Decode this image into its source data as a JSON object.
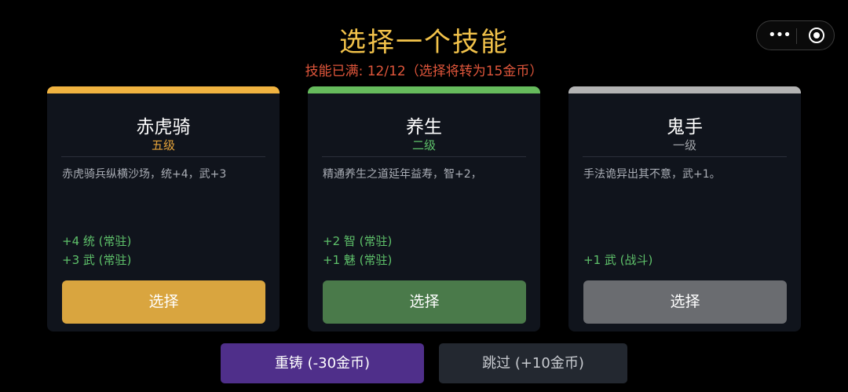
{
  "header": {
    "title": "选择一个技能",
    "subtitle": "技能已满: 12/12（选择将转为15金币）"
  },
  "cards": [
    {
      "name": "赤虎骑",
      "level": "五级",
      "description": "赤虎骑兵纵横沙场，统+4，武+3",
      "stats": [
        "+4 统 (常驻)",
        "+3 武 (常驻)"
      ],
      "button": "选择",
      "colors": {
        "accent": "#f0b340",
        "level": "#e5a33a",
        "button": "#d9a53f"
      }
    },
    {
      "name": "养生",
      "level": "二级",
      "description": "精通养生之道延年益寿，智+2，",
      "stats": [
        "+2 智 (常驻)",
        "+1 魅 (常驻)"
      ],
      "button": "选择",
      "colors": {
        "accent": "#66bb5c",
        "level": "#5ec16a",
        "button": "#4a7a4a"
      }
    },
    {
      "name": "鬼手",
      "level": "一级",
      "description": "手法诡异出其不意，武+1。",
      "stats": [
        "+1 武 (战斗)"
      ],
      "button": "选择",
      "colors": {
        "accent": "#b3b3b3",
        "level": "#a0a3a8",
        "button": "#6a6c70"
      }
    }
  ],
  "footer": {
    "reroll": "重铸 (-30金币)",
    "skip": "跳过 (+10金币)"
  },
  "capsule": {
    "icons": [
      "more-dots-icon",
      "close-target-icon"
    ]
  },
  "colors": {
    "title": "#f2c24a",
    "subtitle": "#e0563b",
    "stat": "#5ec16a",
    "reroll": "#4f2f8a",
    "skip": "#232830"
  }
}
